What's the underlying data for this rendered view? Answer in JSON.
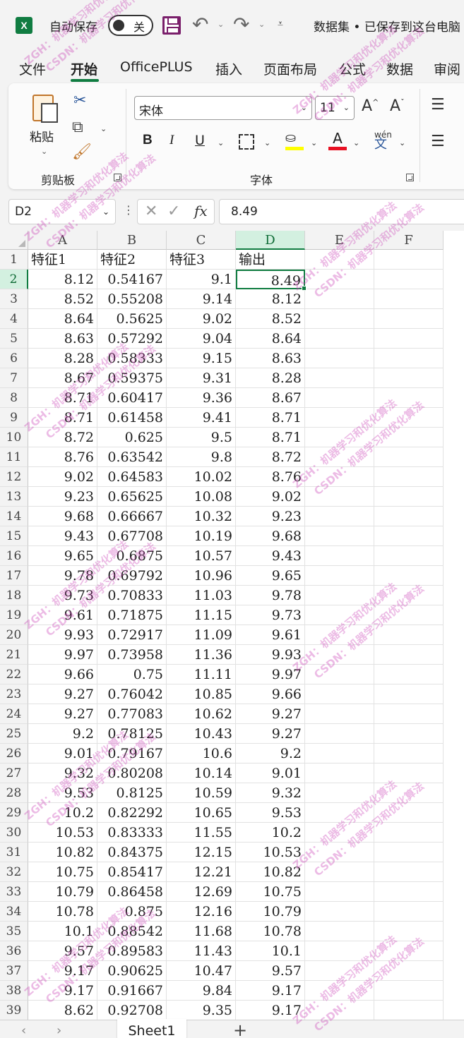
{
  "titlebar": {
    "app_logo": "X",
    "autosave_label": "自动保存",
    "autosave_state": "关",
    "document_title": "数据集 • 已保存到这台电脑"
  },
  "tabs": [
    "文件",
    "开始",
    "OfficePLUS",
    "插入",
    "页面布局",
    "公式",
    "数据",
    "审阅"
  ],
  "active_tab": "开始",
  "ribbon": {
    "clipboard": {
      "paste_label": "粘贴",
      "group_label": "剪贴板"
    },
    "font": {
      "font_name": "宋体",
      "font_size": "11",
      "group_label": "字体",
      "bold": "B",
      "italic": "I",
      "underline": "U",
      "font_color_letter": "A",
      "phonetic_top": "wén",
      "phonetic_char": "文",
      "fill_color": "#ffff00",
      "font_color": "#e81123"
    }
  },
  "formula_bar": {
    "name_box": "D2",
    "fx": "fx",
    "formula": "8.49"
  },
  "grid": {
    "columns": [
      "A",
      "B",
      "C",
      "D",
      "E",
      "F"
    ],
    "selected_column": "D",
    "selected_row": 2,
    "header_row": [
      "特征1",
      "特征2",
      "特征3",
      "输出"
    ],
    "rows": [
      [
        "8.12",
        "0.54167",
        "9.1",
        "8.49"
      ],
      [
        "8.52",
        "0.55208",
        "9.14",
        "8.12"
      ],
      [
        "8.64",
        "0.5625",
        "9.02",
        "8.52"
      ],
      [
        "8.63",
        "0.57292",
        "9.04",
        "8.64"
      ],
      [
        "8.28",
        "0.58333",
        "9.15",
        "8.63"
      ],
      [
        "8.67",
        "0.59375",
        "9.31",
        "8.28"
      ],
      [
        "8.71",
        "0.60417",
        "9.36",
        "8.67"
      ],
      [
        "8.71",
        "0.61458",
        "9.41",
        "8.71"
      ],
      [
        "8.72",
        "0.625",
        "9.5",
        "8.71"
      ],
      [
        "8.76",
        "0.63542",
        "9.8",
        "8.72"
      ],
      [
        "9.02",
        "0.64583",
        "10.02",
        "8.76"
      ],
      [
        "9.23",
        "0.65625",
        "10.08",
        "9.02"
      ],
      [
        "9.68",
        "0.66667",
        "10.32",
        "9.23"
      ],
      [
        "9.43",
        "0.67708",
        "10.19",
        "9.68"
      ],
      [
        "9.65",
        "0.6875",
        "10.57",
        "9.43"
      ],
      [
        "9.78",
        "0.69792",
        "10.96",
        "9.65"
      ],
      [
        "9.73",
        "0.70833",
        "11.03",
        "9.78"
      ],
      [
        "9.61",
        "0.71875",
        "11.15",
        "9.73"
      ],
      [
        "9.93",
        "0.72917",
        "11.09",
        "9.61"
      ],
      [
        "9.97",
        "0.73958",
        "11.36",
        "9.93"
      ],
      [
        "9.66",
        "0.75",
        "11.11",
        "9.97"
      ],
      [
        "9.27",
        "0.76042",
        "10.85",
        "9.66"
      ],
      [
        "9.27",
        "0.77083",
        "10.62",
        "9.27"
      ],
      [
        "9.2",
        "0.78125",
        "10.43",
        "9.27"
      ],
      [
        "9.01",
        "0.79167",
        "10.6",
        "9.2"
      ],
      [
        "9.32",
        "0.80208",
        "10.14",
        "9.01"
      ],
      [
        "9.53",
        "0.8125",
        "10.59",
        "9.32"
      ],
      [
        "10.2",
        "0.82292",
        "10.65",
        "9.53"
      ],
      [
        "10.53",
        "0.83333",
        "11.55",
        "10.2"
      ],
      [
        "10.82",
        "0.84375",
        "12.15",
        "10.53"
      ],
      [
        "10.75",
        "0.85417",
        "12.21",
        "10.82"
      ],
      [
        "10.79",
        "0.86458",
        "12.69",
        "10.75"
      ],
      [
        "10.78",
        "0.875",
        "12.16",
        "10.79"
      ],
      [
        "10.1",
        "0.88542",
        "11.68",
        "10.78"
      ],
      [
        "9.57",
        "0.89583",
        "11.43",
        "10.1"
      ],
      [
        "9.17",
        "0.90625",
        "10.47",
        "9.57"
      ],
      [
        "9.17",
        "0.91667",
        "9.84",
        "9.17"
      ],
      [
        "8.62",
        "0.92708",
        "9.35",
        "9.17"
      ]
    ]
  },
  "sheet_tabs": {
    "sheets": [
      "Sheet1"
    ],
    "add_label": "+"
  },
  "watermark": {
    "line1": "ZGH：机器学习和优化算法",
    "line2": "CSDN：机器学习和优化算法"
  },
  "colors": {
    "excel_green": "#107c41",
    "selection_bg": "#d3f0e0"
  }
}
